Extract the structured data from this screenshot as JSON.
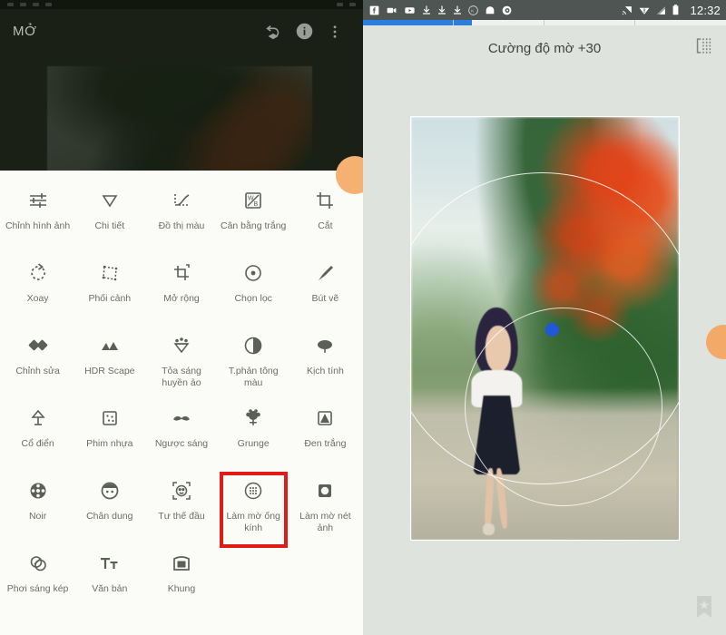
{
  "left_panel": {
    "status_bar": {
      "icon_count": 5,
      "icon_name": "dimmed-status-icon"
    },
    "header": {
      "title": "MỞ",
      "actions": [
        {
          "name": "undo-stack-icon",
          "label": "Hoàn tác"
        },
        {
          "name": "info-icon",
          "label": "Thông tin"
        },
        {
          "name": "overflow-menu-icon",
          "label": "Thêm"
        }
      ]
    },
    "tools": [
      {
        "label": "Chỉnh hình ảnh",
        "icon": "tune-icon"
      },
      {
        "label": "Chi tiết",
        "icon": "details-triangle-icon"
      },
      {
        "label": "Đồ thị màu",
        "icon": "curves-icon"
      },
      {
        "label": "Cân bằng trắng",
        "icon": "white-balance-icon"
      },
      {
        "label": "Cắt",
        "icon": "crop-icon"
      },
      {
        "label": "Xoay",
        "icon": "rotate-icon"
      },
      {
        "label": "Phối cảnh",
        "icon": "perspective-icon"
      },
      {
        "label": "Mở rộng",
        "icon": "expand-icon"
      },
      {
        "label": "Chọn lọc",
        "icon": "selective-icon"
      },
      {
        "label": "Bút vẽ",
        "icon": "brush-icon"
      },
      {
        "label": "Chỉnh sửa",
        "icon": "healing-icon"
      },
      {
        "label": "HDR Scape",
        "icon": "hdr-mountain-icon"
      },
      {
        "label": "Tỏa sáng huyền ảo",
        "icon": "glamour-glow-icon"
      },
      {
        "label": "T.phản tông màu",
        "icon": "tonal-contrast-icon"
      },
      {
        "label": "Kịch tính",
        "icon": "drama-cloud-icon"
      },
      {
        "label": "Cổ điển",
        "icon": "vintage-lamp-icon"
      },
      {
        "label": "Phim nhựa",
        "icon": "grainy-film-icon"
      },
      {
        "label": "Ngược sáng",
        "icon": "retrolux-icon"
      },
      {
        "label": "Grunge",
        "icon": "grunge-icon"
      },
      {
        "label": "Đen trắng",
        "icon": "black-white-icon"
      },
      {
        "label": "Noir",
        "icon": "noir-reel-icon"
      },
      {
        "label": "Chân dung",
        "icon": "portrait-face-icon"
      },
      {
        "label": "Tư thế đầu",
        "icon": "head-pose-icon"
      },
      {
        "label": "Làm mờ ống kính",
        "icon": "lens-blur-icon",
        "highlighted": true
      },
      {
        "label": "Làm mờ nét ảnh",
        "icon": "vignette-icon"
      },
      {
        "label": "Phơi sáng kép",
        "icon": "double-exposure-icon"
      },
      {
        "label": "Văn bản",
        "icon": "text-icon"
      },
      {
        "label": "Khung",
        "icon": "frames-icon"
      }
    ],
    "highlight_color": "#e01b18",
    "sheet_color": "#fbfbf7"
  },
  "right_panel": {
    "status_bar": {
      "left_icons": [
        "facebook-icon",
        "video-camera-icon",
        "youtube-icon",
        "download-icon",
        "download-icon",
        "download-icon",
        "circle-k-icon",
        "arch-icon",
        "camera-disc-icon"
      ],
      "right_icons": [
        "cast-icon",
        "wifi-icon",
        "signal-icon",
        "battery-icon"
      ],
      "clock": "12:32",
      "background": "#4f5553"
    },
    "progress": {
      "segments": 4,
      "filled_fraction": 0.9,
      "accent": "#2d7ddc"
    },
    "header": {
      "title": "Cường độ mờ +30",
      "action": {
        "name": "compare-icon",
        "label": "So sánh"
      }
    },
    "editor": {
      "tool": "Làm mờ ống kính",
      "control_dot": {
        "name": "blur-center-handle",
        "color": "#1f58d8"
      },
      "circles": [
        "outer-blur-ring",
        "inner-blur-ring"
      ]
    }
  }
}
